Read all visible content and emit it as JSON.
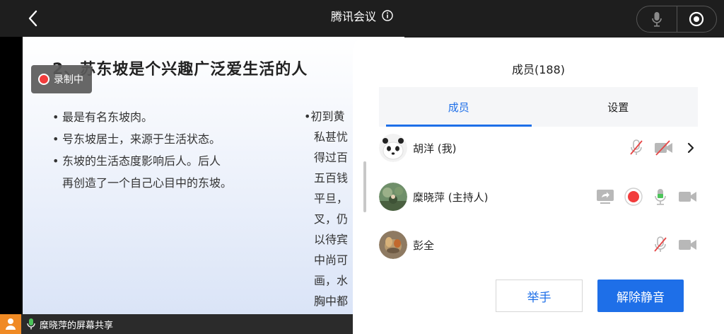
{
  "header": {
    "title": "腾讯会议"
  },
  "slide": {
    "title": "2、苏东坡是个兴趣广泛爱生活的人",
    "left_bullets": [
      [
        "最是有名东坡肉。"
      ],
      [
        "号东坡居士，来源于生活状态。"
      ],
      [
        "东坡的生活态度影响后人。后人",
        "再创造了一个自己心目中的东坡。"
      ]
    ],
    "right_lines": [
      "初到黄",
      "私甚忧",
      "得过百",
      "五百钱",
      "平旦，",
      "叉，仍",
      "以待宾",
      "中尚可",
      "画，水",
      "胸中都"
    ]
  },
  "recording": {
    "label": "录制中"
  },
  "share_bar": {
    "label": "糜晓萍的屏幕共享"
  },
  "panel": {
    "title": "成员(188)",
    "tabs": [
      {
        "label": "成员",
        "active": true
      },
      {
        "label": "设置",
        "active": false
      }
    ],
    "members": [
      {
        "name": "胡洋 (我)"
      },
      {
        "name": "糜晓萍 (主持人)"
      },
      {
        "name": "彭全"
      }
    ],
    "raise_hand_label": "举手",
    "unmute_label": "解除静音"
  },
  "colors": {
    "accent": "#1e6fe8",
    "record": "#f23c3c",
    "mic_active": "#4cc45a",
    "muted_red": "#e64545"
  }
}
